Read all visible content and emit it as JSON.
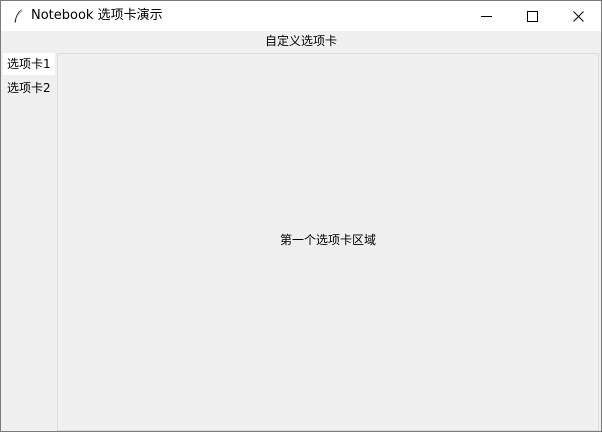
{
  "window": {
    "title": "Notebook 选项卡演示",
    "icon": "feather-icon"
  },
  "caption_buttons": {
    "minimize_icon": "minimize-icon",
    "maximize_icon": "maximize-icon",
    "close_icon": "close-icon"
  },
  "header": {
    "label": "自定义选项卡"
  },
  "tabs": [
    {
      "label": "选项卡1",
      "selected": true
    },
    {
      "label": "选项卡2",
      "selected": false
    }
  ],
  "content": {
    "text": "第一个选项卡区域"
  },
  "colors": {
    "titlebar_bg": "#ffffff",
    "window_bg": "#f0f0f0",
    "active_tab_bg": "#ffffff",
    "border": "#dcdcdc"
  }
}
